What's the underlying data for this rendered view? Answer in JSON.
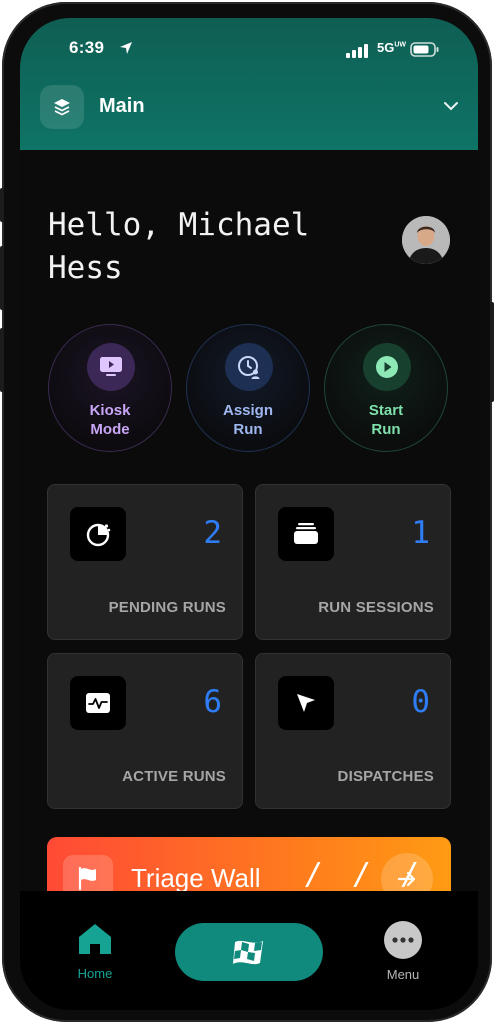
{
  "status_bar": {
    "time": "6:39",
    "network": "5G",
    "network_sup": "UW"
  },
  "workspace": {
    "name": "Main"
  },
  "greeting": {
    "text": "Hello, Michael Hess"
  },
  "quick_actions": [
    {
      "label_line1": "Kiosk",
      "label_line2": "Mode",
      "icon": "monitor-play-icon"
    },
    {
      "label_line1": "Assign",
      "label_line2": "Run",
      "icon": "clock-user-icon"
    },
    {
      "label_line1": "Start",
      "label_line2": "Run",
      "icon": "play-circle-icon"
    }
  ],
  "stats": [
    {
      "count": "2",
      "label": "PENDING RUNS",
      "icon": "timer-icon"
    },
    {
      "count": "1",
      "label": "RUN SESSIONS",
      "icon": "stack-icon"
    },
    {
      "count": "6",
      "label": "ACTIVE RUNS",
      "icon": "activity-icon"
    },
    {
      "count": "0",
      "label": "DISPATCHES",
      "icon": "pointer-arrow-icon"
    }
  ],
  "banner": {
    "title": "Triage Wall",
    "decoration": "/ / /"
  },
  "tabbar": {
    "home_label": "Home",
    "menu_label": "Menu"
  },
  "colors": {
    "header": "#0e7466",
    "accent_teal": "#0f8a7c",
    "stat_count": "#2e7df5",
    "kiosk": "#c9a6f5",
    "assign": "#9fb7ef",
    "start": "#7fe0ac",
    "banner_start": "#ff4a36",
    "banner_end": "#ff9b13"
  }
}
